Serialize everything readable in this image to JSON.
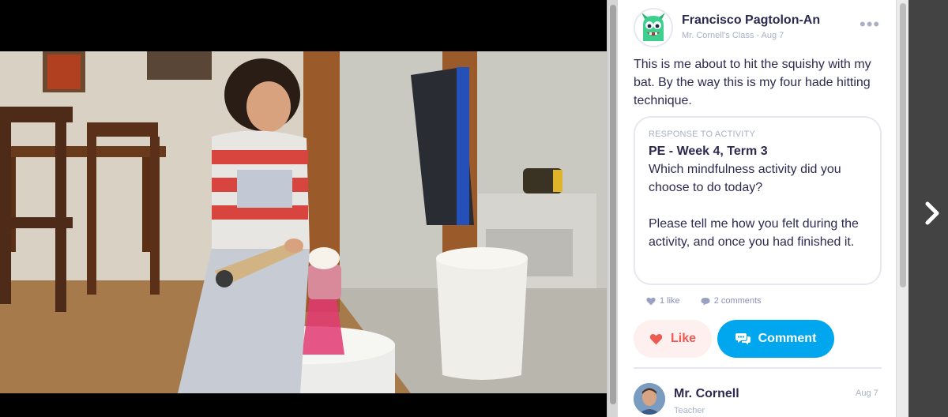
{
  "photo": {
    "icon": "photo-of-child-hitting-cup-with-bat"
  },
  "post": {
    "author": "Francisco Pagtolon-An",
    "meta": "Mr. Cornell's Class - Aug 7",
    "more_label": "•••",
    "body": "This is me about to hit the squishy with my bat. By the way this is my four hade hitting technique.",
    "activity": {
      "label": "RESPONSE TO ACTIVITY",
      "title": "PE - Week 4, Term 3",
      "question": "Which mindfulness activity did you choose to do today?\n\nPlease tell me how you felt during the activity, and once you had finished it."
    },
    "likes_label": "1 like",
    "comments_label": "2 comments",
    "like_button": "Like",
    "comment_button": "Comment"
  },
  "comment": {
    "name": "Mr. Cornell",
    "role": "Teacher",
    "date": "Aug 7"
  },
  "colors": {
    "accent": "#00a7ee",
    "like": "#ee5a52",
    "text": "#2c2a50",
    "muted": "#aab0c6",
    "monster": "#3ccf8e"
  }
}
